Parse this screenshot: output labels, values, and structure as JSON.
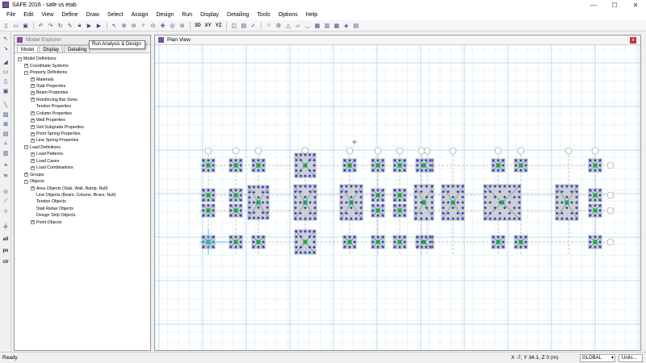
{
  "window": {
    "title": "SAFE 2016 - safe vs etab",
    "minimize": "—",
    "maximize": "☐",
    "close": "✕"
  },
  "menu": [
    "File",
    "Edit",
    "View",
    "Define",
    "Draw",
    "Select",
    "Assign",
    "Design",
    "Run",
    "Display",
    "Detailing",
    "Tools",
    "Options",
    "Help"
  ],
  "toolbar": {
    "icons": [
      "new-icon",
      "open-icon",
      "save-icon",
      "undo-icon",
      "redo-icon",
      "refresh-icon",
      "pencil-icon",
      "lock-icon",
      "run-icon",
      "run-locked-icon",
      "pointer-icon",
      "zoom-in-icon",
      "zoom-out-icon",
      "zoom-window-icon",
      "zoom-fit-icon",
      "pan-icon",
      "zoom-prev-icon",
      "zoom-next-icon"
    ],
    "view_labels": [
      "3D",
      "XY",
      "YZ"
    ],
    "trailing_icons": [
      "perspective-icon",
      "display-options-icon",
      "check-icon",
      "circle-icon",
      "gear-icon",
      "triangle-icon",
      "slab-icon",
      "deform-icon",
      "cube-icon",
      "wall-icon",
      "grid-icon",
      "spring-icon",
      "strip-icon"
    ]
  },
  "tooltip": "Run Analysis & Design",
  "left_tools": {
    "icons": [
      "select-arrow-icon",
      "reshape-icon",
      "draw-area-icon",
      "draw-rect-icon",
      "draw-quad-icon",
      "draw-point-icon",
      "draw-line-icon",
      "draw-beam-icon",
      "draw-column-icon",
      "draw-wall-icon",
      "draw-spring-icon",
      "draw-strip-icon",
      "snap-point-icon",
      "snap-line-icon",
      "snap-intersection-icon"
    ],
    "labels": [
      "all",
      "ps",
      "clr"
    ]
  },
  "explorer": {
    "title": "Model Explorer",
    "tabs": [
      "Model",
      "Display",
      "Detailing"
    ],
    "tree": [
      {
        "level": 0,
        "box": "−",
        "label": "Model Definitions"
      },
      {
        "level": 1,
        "box": "+",
        "label": "Coordinate Systems"
      },
      {
        "level": 1,
        "box": "−",
        "label": "Property Definitions"
      },
      {
        "level": 2,
        "box": "+",
        "label": "Materials"
      },
      {
        "level": 2,
        "box": "+",
        "label": "Slab Properties"
      },
      {
        "level": 2,
        "box": "+",
        "label": "Beam Properties"
      },
      {
        "level": 2,
        "box": "+",
        "label": "Reinforcing Bar Sizes"
      },
      {
        "level": 2,
        "box": "",
        "label": "Tendon Properties"
      },
      {
        "level": 2,
        "box": "+",
        "label": "Column Properties"
      },
      {
        "level": 2,
        "box": "+",
        "label": "Wall Properties"
      },
      {
        "level": 2,
        "box": "+",
        "label": "Soil Subgrade Properties"
      },
      {
        "level": 2,
        "box": "+",
        "label": "Point Spring Properties"
      },
      {
        "level": 2,
        "box": "+",
        "label": "Line Spring Properties"
      },
      {
        "level": 1,
        "box": "−",
        "label": "Load Definitions"
      },
      {
        "level": 2,
        "box": "+",
        "label": "Load Patterns"
      },
      {
        "level": 2,
        "box": "+",
        "label": "Load Cases"
      },
      {
        "level": 2,
        "box": "+",
        "label": "Load Combinations"
      },
      {
        "level": 1,
        "box": "+",
        "label": "Groups"
      },
      {
        "level": 1,
        "box": "−",
        "label": "Objects"
      },
      {
        "level": 2,
        "box": "+",
        "label": "Area Objects (Slab, Wall, Ramp, Null)"
      },
      {
        "level": 2,
        "box": "",
        "label": "Line Objects (Beam, Column, Brace, Null)"
      },
      {
        "level": 2,
        "box": "",
        "label": "Tendon Objects"
      },
      {
        "level": 2,
        "box": "",
        "label": "Slab Rebar Objects"
      },
      {
        "level": 2,
        "box": "",
        "label": "Design Strip Objects"
      },
      {
        "level": 2,
        "box": "+",
        "label": "Point Objects"
      }
    ]
  },
  "plan": {
    "title": "Plan View",
    "close": "x"
  },
  "status": {
    "left": "Ready",
    "coords": "X -7,  Y 34.1,  Z 0   (m)",
    "coord_system": "GLOBAL",
    "units": "Units..."
  },
  "colors": {
    "accent_purple": "#7b4fa0",
    "grid_line": "#a9d2ef",
    "footing_fill": "#cfcfcf",
    "column_blue": "#2b3fd0",
    "rebar_green": "#1aa64a"
  }
}
